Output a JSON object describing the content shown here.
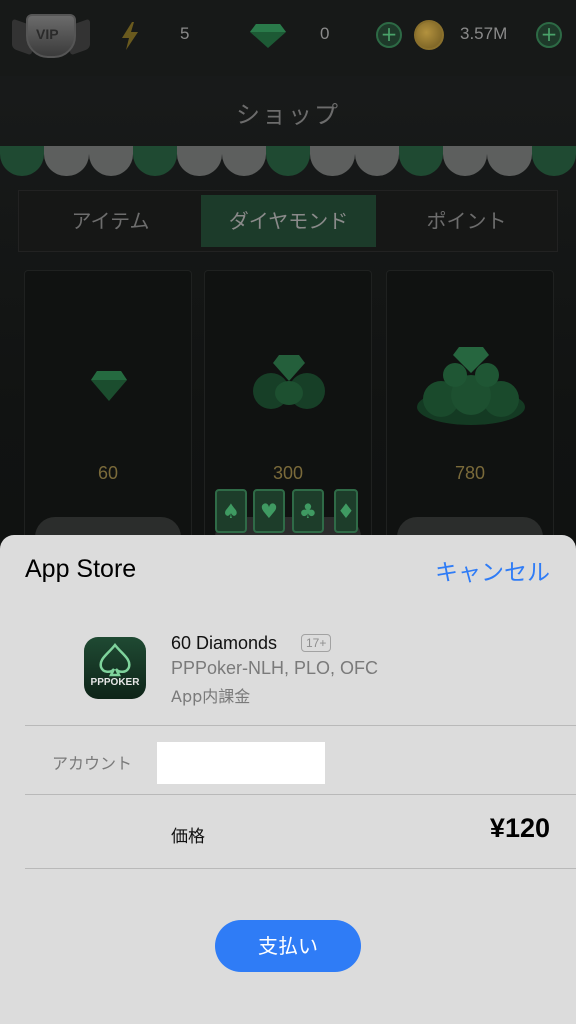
{
  "topbar": {
    "vip_label": "VIP",
    "energy_count": "5",
    "diamond_count": "0",
    "coin_balance": "3.57M"
  },
  "shop": {
    "title": "ショップ",
    "tabs": [
      {
        "label": "アイテム"
      },
      {
        "label": "ダイヤモンド",
        "active": true
      },
      {
        "label": "ポイント"
      }
    ],
    "cards": [
      {
        "amount": "60"
      },
      {
        "amount": "300"
      },
      {
        "amount": "780"
      }
    ],
    "suits": [
      "♠",
      "♥",
      "♣",
      "♦"
    ]
  },
  "sheet": {
    "title": "App Store",
    "cancel_label": "キャンセル",
    "product_name": "60 Diamonds",
    "age_rating": "17+",
    "app_name": "PPPoker-NLH, PLO, OFC",
    "purchase_type": "App内課金",
    "app_icon_text": "PPPOKER",
    "account_label": "アカウント",
    "price_label": "価格",
    "price_value": "¥120",
    "pay_label": "支払い"
  },
  "colors": {
    "accent_blue": "#2f7cf6",
    "sheet_bg": "#dcdcdc",
    "game_green": "#1c3b2a"
  }
}
